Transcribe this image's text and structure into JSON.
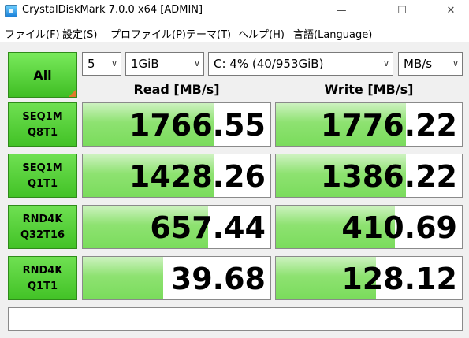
{
  "window": {
    "title": "CrystalDiskMark 7.0.0 x64 [ADMIN]",
    "min_glyph": "—",
    "max_glyph": "☐",
    "close_glyph": "✕"
  },
  "menu": {
    "items": [
      "ファイル(F)",
      "設定(S)",
      "プロファイル(P)",
      "テーマ(T)",
      "ヘルプ(H)",
      "言語(Language)"
    ]
  },
  "controls": {
    "all_label": "All",
    "count": "5",
    "size": "1GiB",
    "drive": "C: 4% (40/953GiB)",
    "unit": "MB/s",
    "dropdown_arrow": "∨"
  },
  "columns": {
    "read": "Read [MB/s]",
    "write": "Write [MB/s]"
  },
  "rows": [
    {
      "line1": "SEQ1M",
      "line2": "Q8T1",
      "read": "1766.55",
      "write": "1776.22",
      "read_fill": 0.7,
      "write_fill": 0.7
    },
    {
      "line1": "SEQ1M",
      "line2": "Q1T1",
      "read": "1428.26",
      "write": "1386.22",
      "read_fill": 0.7,
      "write_fill": 0.7
    },
    {
      "line1": "RND4K",
      "line2": "Q32T16",
      "read": "657.44",
      "write": "410.69",
      "read_fill": 0.67,
      "write_fill": 0.64
    },
    {
      "line1": "RND4K",
      "line2": "Q1T1",
      "read": "39.68",
      "write": "128.12",
      "read_fill": 0.43,
      "write_fill": 0.54
    }
  ],
  "status": {
    "text": ""
  },
  "colors": {
    "bar_green": "#7adc5c",
    "button_green": "#42c226",
    "accent_orange": "#e07a2a"
  }
}
